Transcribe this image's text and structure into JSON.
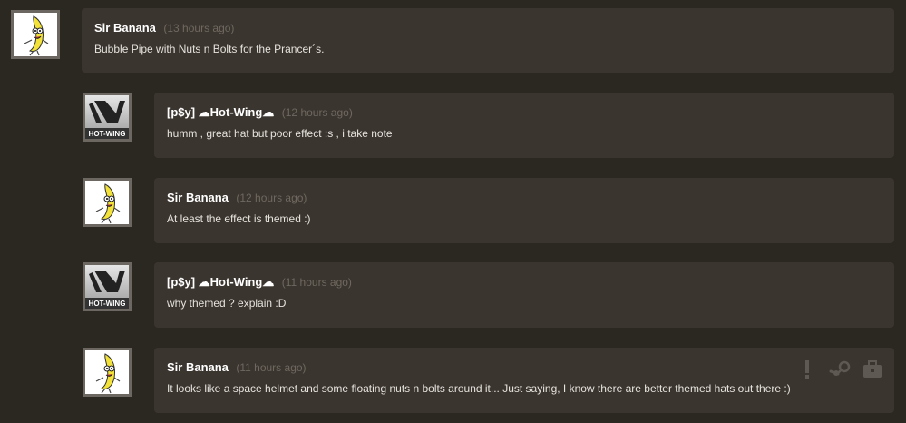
{
  "avatars": {
    "hotwing_text": "HOT-WING"
  },
  "comments": [
    {
      "author": "Sir Banana",
      "timestamp": "(13 hours ago)",
      "text": "Bubble Pipe with Nuts n Bolts for the Prancer´s."
    },
    {
      "author": "[p$y] ☁Hot-Wing☁",
      "timestamp": "(12 hours ago)",
      "text": "humm , great hat but poor effect :s , i take note"
    },
    {
      "author": "Sir Banana",
      "timestamp": "(12 hours ago)",
      "text": "At least the effect is themed :)"
    },
    {
      "author": "[p$y] ☁Hot-Wing☁",
      "timestamp": "(11 hours ago)",
      "text": "why themed ? explain :D"
    },
    {
      "author": "Sir Banana",
      "timestamp": "(11 hours ago)",
      "text": "It looks like a space helmet and some floating nuts n bolts around it... Just saying, I know there are better themed hats out there :)"
    }
  ],
  "actions": [
    "report-icon",
    "steam-icon",
    "briefcase-icon"
  ],
  "colors": {
    "background": "#2b2721",
    "bubble": "#3b352f",
    "author": "#ffffff",
    "timestamp": "#6e6860",
    "body": "#e6e3de",
    "action_icon": "#5e5952"
  }
}
